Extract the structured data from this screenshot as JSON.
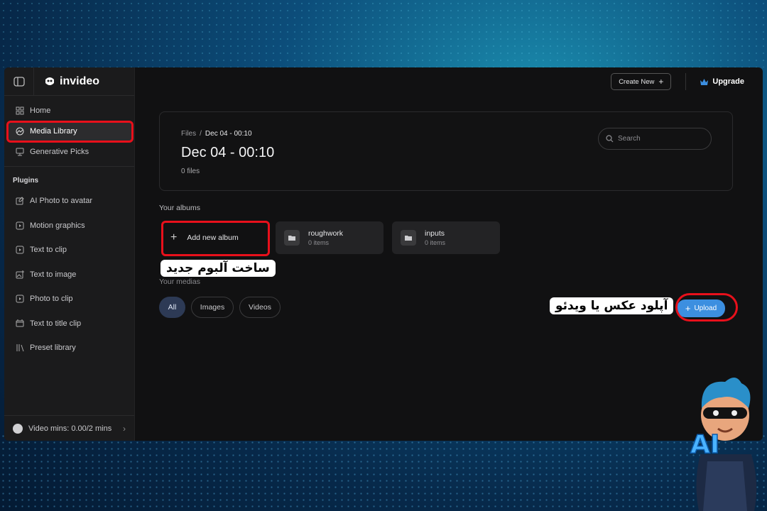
{
  "brand": {
    "name": "invideo"
  },
  "sidebar": {
    "nav": [
      {
        "label": "Home",
        "icon": "grid-icon"
      },
      {
        "label": "Media Library",
        "icon": "media-library-icon"
      },
      {
        "label": "Generative Picks",
        "icon": "monitor-icon"
      }
    ],
    "plugins_title": "Plugins",
    "plugins": [
      {
        "label": "AI Photo to avatar",
        "icon": "photo-edit-icon"
      },
      {
        "label": "Motion graphics",
        "icon": "play-square-icon"
      },
      {
        "label": "Text to clip",
        "icon": "play-square-icon"
      },
      {
        "label": "Text to image",
        "icon": "image-plus-icon"
      },
      {
        "label": "Photo to clip",
        "icon": "play-square-icon"
      },
      {
        "label": "Text to title clip",
        "icon": "title-clip-icon"
      },
      {
        "label": "Preset library",
        "icon": "library-icon"
      }
    ],
    "footer": "Video mins: 0.00/2 mins"
  },
  "topbar": {
    "create_new": "Create New",
    "upgrade": "Upgrade"
  },
  "header": {
    "breadcrumb_root": "Files",
    "breadcrumb_sep": "/",
    "breadcrumb_current": "Dec 04 - 00:10",
    "title": "Dec 04 - 00:10",
    "file_count": "0 files",
    "search_placeholder": "Search"
  },
  "albums": {
    "title": "Your albums",
    "add_label": "Add new album",
    "items": [
      {
        "name": "roughwork",
        "count": "0 items"
      },
      {
        "name": "inputs",
        "count": "0 items"
      }
    ]
  },
  "medias": {
    "title": "Your medias",
    "filters": [
      "All",
      "Images",
      "Videos"
    ],
    "active_filter": "All",
    "upload_label": "Upload"
  },
  "annotations": {
    "new_album": "ساخت آلبوم جدید",
    "upload": "آپلود عکس یا ویدئو",
    "mascot_text": "AI"
  },
  "colors": {
    "accent": "#3c8fe0",
    "highlight": "#e8101b",
    "window_bg": "#111112"
  }
}
